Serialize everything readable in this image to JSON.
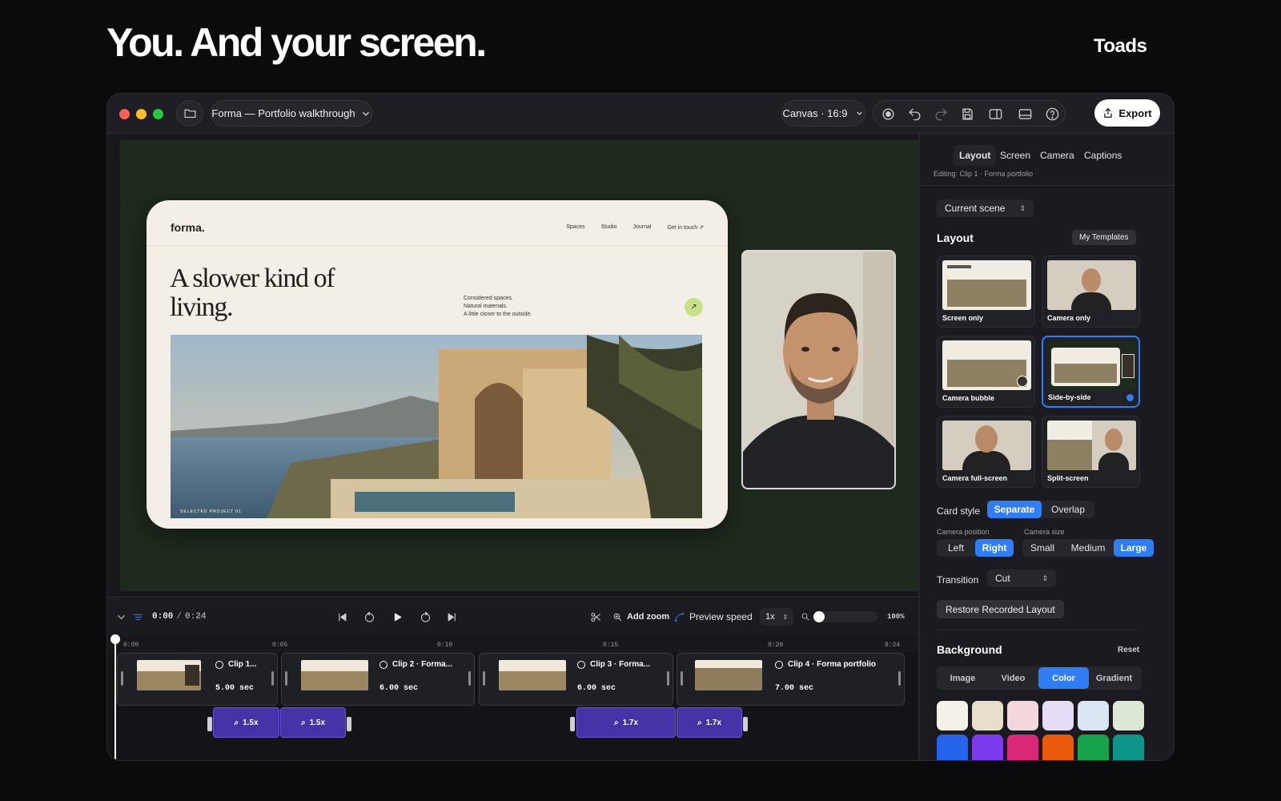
{
  "hero_title": "You. And your screen.",
  "brand": "Toads",
  "titlebar": {
    "project": "Forma — Portfolio walkthrough",
    "canvas": "Canvas · 16:9",
    "export_label": "Export"
  },
  "site": {
    "logo": "forma.",
    "nav": [
      "Spaces",
      "Studio",
      "Journal",
      "Get in touch ↗"
    ],
    "headline": "A slower kind of living.",
    "blurb": [
      "Considered spaces.",
      "Natural materials.",
      "A little closer to the outside."
    ],
    "caption": "SELECTED PROJECT  01"
  },
  "controls": {
    "time_current": "0:00",
    "time_sep": "/",
    "time_total": "0:24",
    "add_zoom": "Add zoom",
    "preview_speed": "Preview speed",
    "speed": "1x",
    "zoom_level": "100%"
  },
  "ruler": [
    "0:00",
    "0:05",
    "0:10",
    "0:15",
    "0:20",
    "0:24"
  ],
  "clips": [
    {
      "title": "Clip 1...",
      "duration": "5.00 sec"
    },
    {
      "title": "Clip 2 · Forma...",
      "duration": "6.00 sec"
    },
    {
      "title": "Clip 3 · Forma...",
      "duration": "6.00 sec"
    },
    {
      "title": "Clip 4 · Forma portfolio",
      "duration": "7.00 sec"
    }
  ],
  "zooms": [
    "1.5x",
    "1.5x",
    "1.7x",
    "1.7x"
  ],
  "panel": {
    "tabs": [
      "Layout",
      "Screen",
      "Camera",
      "Captions"
    ],
    "active_tab": "Layout",
    "editing": "Editing: Clip 1 · Forma portfolio",
    "scene": "Current scene",
    "layout_heading": "Layout",
    "my_templates": "My Templates",
    "layouts": [
      "Screen only",
      "Camera only",
      "Camera bubble",
      "Side-by-side",
      "Camera full-screen",
      "Split-screen"
    ],
    "selected_layout": "Side-by-side",
    "card_style_label": "Card style",
    "card_style": [
      "Separate",
      "Overlap"
    ],
    "card_style_selected": "Separate",
    "camera_position_label": "Camera position",
    "camera_position": [
      "Left",
      "Right"
    ],
    "camera_position_selected": "Right",
    "camera_size_label": "Camera size",
    "camera_size": [
      "Small",
      "Medium",
      "Large"
    ],
    "camera_size_selected": "Large",
    "transition_label": "Transition",
    "transition": "Cut",
    "restore": "Restore Recorded Layout",
    "background_heading": "Background",
    "reset": "Reset",
    "background_tabs": [
      "Image",
      "Video",
      "Color",
      "Gradient"
    ],
    "background_selected": "Color",
    "swatches": [
      "#f5f1e8",
      "#e8dccb",
      "#f4d7dd",
      "#e6dcf5",
      "#d9e6f1",
      "#dbe8d6"
    ],
    "swatches_row2": [
      "#2563eb",
      "#7c3aed",
      "#db2777",
      "#ea580c",
      "#16a34a",
      "#0d9488"
    ]
  },
  "colors": {
    "accent": "#2f7ef5",
    "zoom": "#4432a6",
    "stage": "#1e2a1d"
  }
}
